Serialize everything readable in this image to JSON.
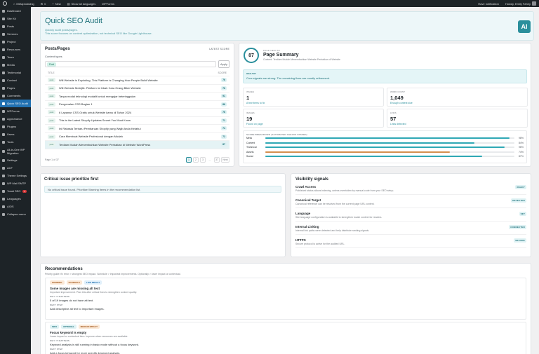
{
  "adminbar": {
    "site": "Metaproduling",
    "comments": "0",
    "new": "New",
    "languages": "Show all languages",
    "wpforms": "WPForms",
    "notifications": "Have notification",
    "howdy": "Howdy, Emily Fahey"
  },
  "sidebar": [
    {
      "label": "Dashboard"
    },
    {
      "label": "Site Kit"
    },
    {
      "label": "Posts"
    },
    {
      "label": "Services"
    },
    {
      "label": "Project"
    },
    {
      "label": "Resources"
    },
    {
      "label": "Team"
    },
    {
      "label": "Media"
    },
    {
      "label": "Testimonial"
    },
    {
      "label": "Contact"
    },
    {
      "label": "Pages"
    },
    {
      "label": "Comments"
    },
    {
      "label": "Quick SEO Audit",
      "active": true
    },
    {
      "label": "WPForms"
    },
    {
      "label": "Appearance"
    },
    {
      "label": "Plugins"
    },
    {
      "label": "Users"
    },
    {
      "label": "Tools"
    },
    {
      "label": "All-in-One WP Migration",
      "multi": true
    },
    {
      "label": "Settings"
    },
    {
      "label": "ACF"
    },
    {
      "label": "Theme Settings"
    },
    {
      "label": "WP Mail SMTP"
    },
    {
      "label": "Yoast SEO",
      "badge": "2"
    },
    {
      "label": "Languages"
    },
    {
      "label": "AIOS"
    },
    {
      "label": "Collapse menu"
    }
  ],
  "header": {
    "title": "Quick SEO Audit",
    "subtitle1": "Quickly audit posts/pages.",
    "subtitle2": "This score focuses on content optimization, not technical SEO like Google Lighthouse.",
    "logo": "AI"
  },
  "posts": {
    "title": "Posts/Pages",
    "latest": "LATEST SCORE",
    "content_types_label": "Content types",
    "chip": "Post",
    "apply": "Apply",
    "col_title": "TITLE",
    "col_score": "SCORE",
    "rows": [
      {
        "type": "post",
        "title": "Will Website is Exploding. This Platform is Changing How People Build Website",
        "score": "76"
      },
      {
        "type": "post",
        "title": "Will Website Melejitk. Platform ini Ubah Cara Orang Bikin Website",
        "score": "76"
      },
      {
        "type": "post",
        "title": "Tanpa modal teknologi modaliti untuk mengajar beteringgalan",
        "score": "91"
      },
      {
        "type": "post",
        "title": "Pengenalan CSS Bagian 1",
        "score": "86"
      },
      {
        "type": "post",
        "title": "6 Layanan CSS Gratis untuk Website kamu di Tahun 2024",
        "score": "76"
      },
      {
        "type": "post",
        "title": "This is the Latest Shopify Updates Secret You Must Know",
        "score": "71"
      },
      {
        "type": "post",
        "title": "Ini Rahasia Terbaru Pembaruan Shopify yang Wajib Anda Ketahui",
        "score": "74"
      },
      {
        "type": "post",
        "title": "Cara Membuat Website Profesional dengan Mudah",
        "score": "72"
      },
      {
        "type": "post",
        "title": "Terdiam Mudah Menembahkan Website Perbaikan di Website WordPress",
        "score": "87",
        "selected": true
      }
    ],
    "page_count": "Page 1 of 37",
    "pages": [
      "1",
      "2",
      "3",
      "...",
      "37",
      "Next"
    ]
  },
  "summary": {
    "score": "87",
    "page_health": "PAGE HEALTH",
    "title": "Page Summary",
    "subtitle": "Content: Terdiam Mudah Menembahkan Website Perbaikan di Website",
    "healthy_label": "HEALTHY",
    "healthy_text": "Core signals are strong. The remaining fixes are mostly refinement.",
    "stats": [
      {
        "label": "ISSUES",
        "value": "1",
        "note": "A few items to fix"
      },
      {
        "label": "WORD COUNT",
        "value": "1,049",
        "note": "Enough content size"
      },
      {
        "label": "IMAGES",
        "value": "19",
        "note": "Found on page"
      },
      {
        "label": "LINKS",
        "value": "57",
        "note": "Links detected"
      }
    ],
    "breakdown_label": "SCORE BREAKDOWN (AUTOMATED CHECKS PASSED)",
    "breakdown": [
      {
        "name": "Meta",
        "pct": "98%",
        "value": 0.98,
        "color": "#2fa8b5"
      },
      {
        "name": "Content",
        "pct": "84%",
        "value": 0.84,
        "color": "#2fa8b5"
      },
      {
        "name": "Technical",
        "pct": "96%",
        "value": 0.96,
        "color": "#2fa8b5"
      },
      {
        "name": "Assets",
        "pct": "74%",
        "value": 0.74,
        "color": "#d48f4e"
      },
      {
        "name": "Social",
        "pct": "87%",
        "value": 0.87,
        "color": "#2fa8b5"
      }
    ]
  },
  "critical": {
    "title": "Critical issue prioritize first",
    "empty": "No critical issue found. Prioritize Warning items in the recommendation list."
  },
  "visibility": {
    "title": "Visibility signals",
    "signals": [
      {
        "name": "Crawl Access",
        "desc": "Published status allows indexing, unless overridden by manual code from your SEO setup.",
        "badge": "READY"
      },
      {
        "name": "Canonical Target",
        "desc": "Canonical reference can be resolved from the current page URL context.",
        "badge": "DETECTED"
      },
      {
        "name": "Language",
        "desc": "Site language configuration is available to strengthen locale context for readers.",
        "badge": "SET"
      },
      {
        "name": "Internal Linking",
        "desc": "Internal link paths were detected and help distribute ranking signals.",
        "badge": "CONNECTED"
      },
      {
        "name": "HTTPS",
        "desc": "Secure protocol is active for the audited URL.",
        "badge": "SECURE"
      }
    ]
  },
  "recs": {
    "title": "Recommendations",
    "subtitle": "Priority guide: fix error > strongest SEO impact. Schedule > important improvements. Optionally > lower impact or contextual.",
    "items": [
      {
        "tags": [
          {
            "text": "WARNING",
            "bg": "#fbe8d6",
            "fg": "#a1571b"
          },
          {
            "text": "SCHEDULE",
            "bg": "#fbe8d6",
            "fg": "#a1571b"
          },
          {
            "text": "LOW IMPACT",
            "bg": "#e1f0fb",
            "fg": "#2271b1"
          }
        ],
        "title": "Some images are missing alt text",
        "desc": "Important improvement. Plan this after critical fixes to strengthen content quality.",
        "why_label": "WHY IT MATTERS",
        "why": "5 of 19 images do not have alt text.",
        "next_label": "NEXT STEP",
        "next": "Add descriptive alt text to important images."
      },
      {
        "tags": [
          {
            "text": "INFO",
            "bg": "#dff2f4",
            "fg": "#1b6f78"
          },
          {
            "text": "OPTIONAL",
            "bg": "#dff2f4",
            "fg": "#1b6f78"
          },
          {
            "text": "MEDIUM IMPACT",
            "bg": "#fbe8d6",
            "fg": "#a1571b"
          }
        ],
        "title": "Focus keyword is empty",
        "desc": "Lower impact or contextual item. Improve when resources are available.",
        "why_label": "WHY IT MATTERS",
        "why": "Keyword analysis is still running in basic mode without a focus keyword.",
        "next_label": "NEXT STEP",
        "next": "Add a focus keyword for more specific keyword analysis."
      }
    ]
  }
}
